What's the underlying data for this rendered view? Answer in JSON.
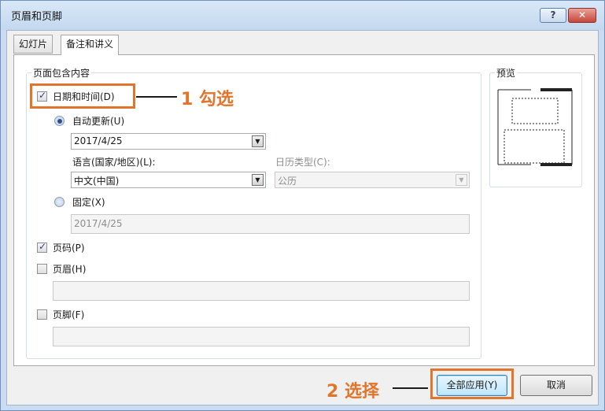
{
  "window": {
    "title": "页眉和页脚",
    "help_label": "?",
    "close_label": "✕"
  },
  "tabs": [
    {
      "label": "幻灯片"
    },
    {
      "label": "备注和讲义"
    }
  ],
  "include_group": {
    "title": "页面包含内容",
    "date_time": {
      "label": "日期和时间(D)",
      "checked": true
    },
    "auto_update": {
      "label": "自动更新(U)",
      "selected": true,
      "value": "2017/4/25"
    },
    "language": {
      "label": "语言(国家/地区)(L):",
      "value": "中文(中国)"
    },
    "calendar": {
      "label": "日历类型(C):",
      "value": "公历"
    },
    "fixed": {
      "label": "固定(X)",
      "selected": false,
      "value": "2017/4/25"
    },
    "page_number": {
      "label": "页码(P)",
      "checked": true
    },
    "header": {
      "label": "页眉(H)",
      "checked": false,
      "value": ""
    },
    "footer": {
      "label": "页脚(F)",
      "checked": false,
      "value": ""
    }
  },
  "preview": {
    "title": "预览"
  },
  "buttons": {
    "apply_all": "全部应用(Y)",
    "cancel": "取消"
  },
  "annotations": {
    "step1": "1 勾选",
    "step2": "2 选择",
    "color": "#e2752c"
  }
}
